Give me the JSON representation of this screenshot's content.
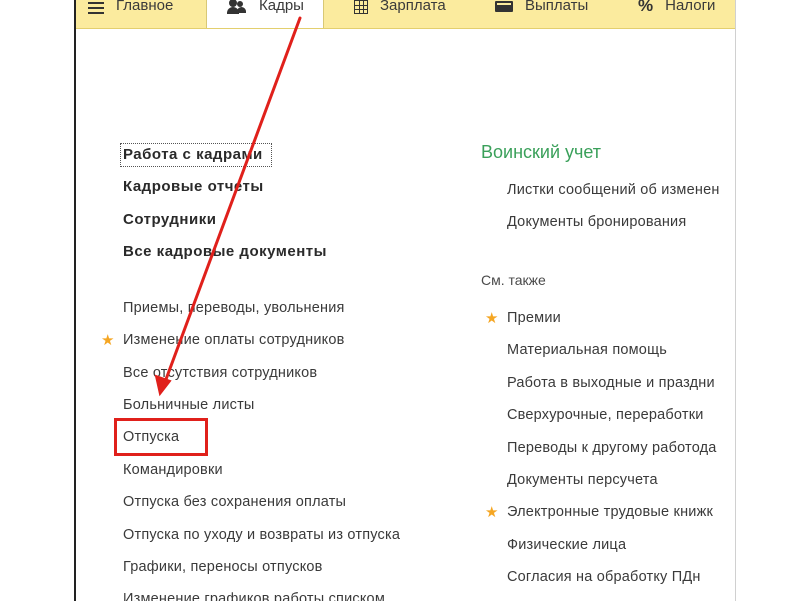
{
  "toolbar": {
    "tabs": [
      {
        "label": "Главное",
        "icon": "menu-icon"
      },
      {
        "label": "Кадры",
        "icon": "people-icon"
      },
      {
        "label": "Зарплата",
        "icon": "grid-icon"
      },
      {
        "label": "Выплаты",
        "icon": "wallet-icon"
      },
      {
        "label": "Налоги",
        "icon": "percent-icon"
      }
    ],
    "active_tab": "Кадры"
  },
  "left_column": {
    "main_links": [
      "Работа с кадрами",
      "Кадровые отчеты",
      "Сотрудники",
      "Все кадровые документы"
    ],
    "doc_links": [
      "Приемы, переводы, увольнения",
      "Изменение оплаты сотрудников",
      "Все отсутствия сотрудников",
      "Больничные листы",
      "Отпуска",
      "Командировки",
      "Отпуска без сохранения оплаты",
      "Отпуска по уходу и возвраты из отпуска",
      "Графики, переносы отпусков",
      "Изменение графиков работы списком"
    ]
  },
  "right_column": {
    "military_title": "Воинский учет",
    "military_links": [
      "Листки сообщений об изменен",
      "Документы бронирования"
    ],
    "see_also_label": "См. также",
    "see_also_links": [
      "Премии",
      "Материальная помощь",
      "Работа в выходные и праздни",
      "Сверхурочные, переработки",
      "Переводы к другому работода",
      "Документы персучета",
      "Электронные трудовые книжк",
      "Физические лица",
      "Согласия на обработку ПДн"
    ]
  },
  "colors": {
    "toolbar_bg": "#fbeb9e",
    "section_green": "#3aa05a",
    "star_orange": "#f5a623",
    "annotation_red": "#e0201b"
  }
}
